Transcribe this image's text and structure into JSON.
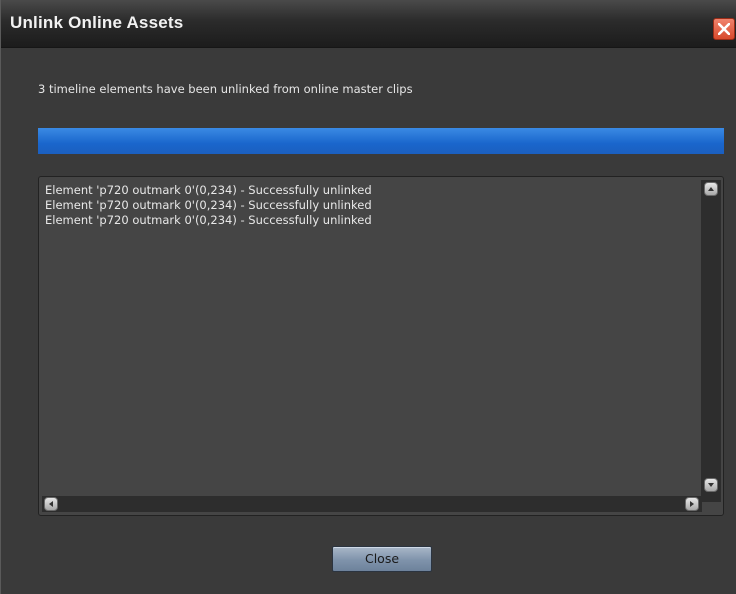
{
  "window": {
    "title": "Unlink Online Assets"
  },
  "message": "3 timeline elements have been unlinked from online master clips",
  "progress": {
    "value_percent": 100,
    "color": "#1f6fd6"
  },
  "log": {
    "lines": [
      "Element 'p720 outmark 0'(0,234) - Successfully unlinked",
      "Element 'p720 outmark 0'(0,234) - Successfully unlinked",
      "Element 'p720 outmark 0'(0,234) - Successfully unlinked"
    ]
  },
  "buttons": {
    "close_label": "Close"
  },
  "icons": {
    "title_close": "close-icon",
    "scroll_up": "scroll-up-icon",
    "scroll_down": "scroll-down-icon",
    "scroll_left": "scroll-left-icon",
    "scroll_right": "scroll-right-icon"
  }
}
